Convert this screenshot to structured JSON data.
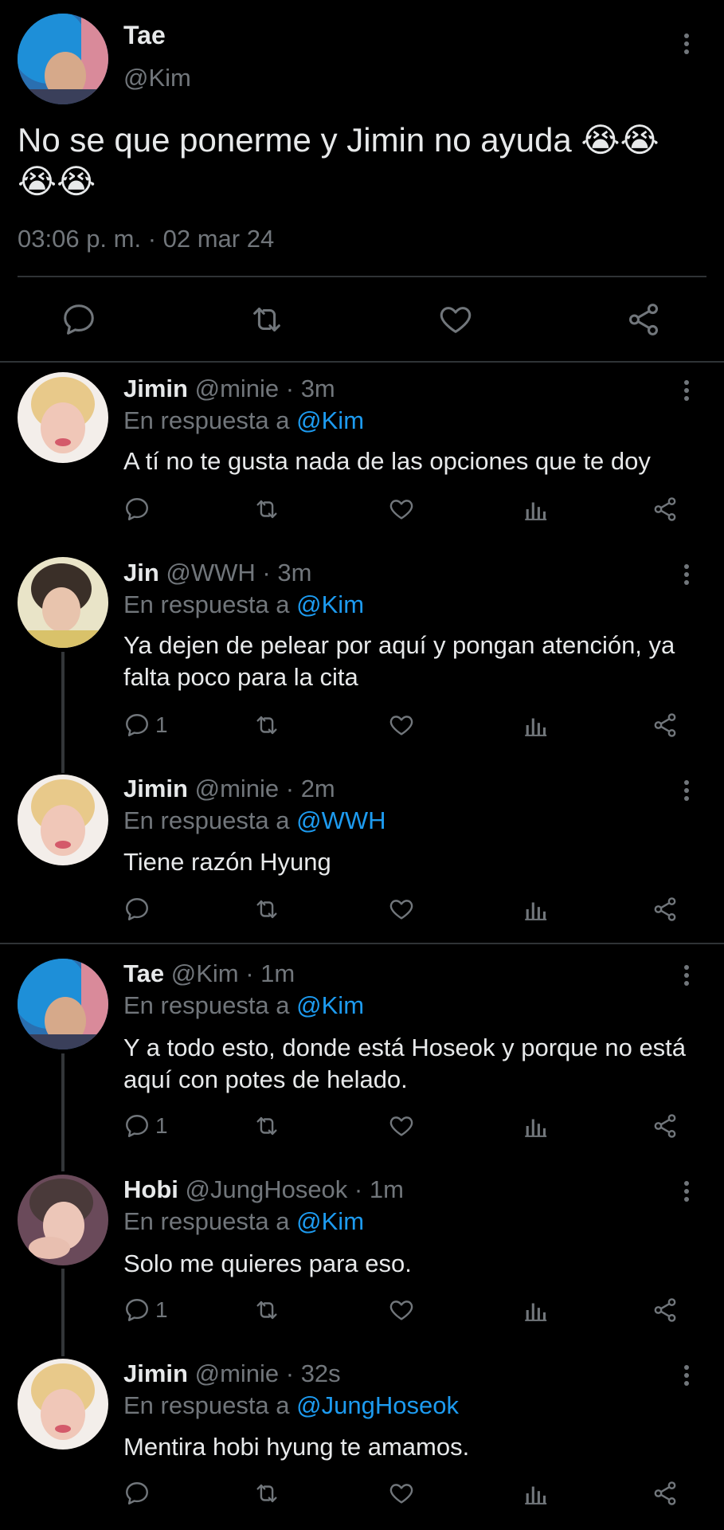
{
  "main_tweet": {
    "name": "Tae",
    "handle": "@Kim",
    "text": "No se que ponerme y Jimin no ayuda 😭😭😭😭",
    "timestamp": "03:06 p. m. · 02 mar 24"
  },
  "replies": [
    {
      "name": "Jimin",
      "meta": "@minie · 3m",
      "reply_prefix": "En respuesta a",
      "reply_to": "@Kim",
      "text": "A tí no te gusta nada de las opciones que te doy",
      "reply_count": ""
    },
    {
      "name": "Jin",
      "meta": "@WWH · 3m",
      "reply_prefix": "En respuesta a",
      "reply_to": "@Kim",
      "text": "Ya dejen de pelear por aquí y pongan atención, ya falta poco para la cita",
      "reply_count": "1"
    },
    {
      "name": "Jimin",
      "meta": "@minie · 2m",
      "reply_prefix": "En respuesta a",
      "reply_to": "@WWH",
      "text": "Tiene razón Hyung",
      "reply_count": ""
    },
    {
      "name": "Tae",
      "meta": "@Kim · 1m",
      "reply_prefix": "En respuesta a",
      "reply_to": "@Kim",
      "text": "Y a todo esto, donde está Hoseok y porque no está aquí con potes de helado.",
      "reply_count": "1"
    },
    {
      "name": "Hobi",
      "meta": "@JungHoseok · 1m",
      "reply_prefix": "En respuesta a",
      "reply_to": "@Kim",
      "text": "Solo me quieres para eso.",
      "reply_count": "1"
    },
    {
      "name": "Jimin",
      "meta": "@minie · 32s",
      "reply_prefix": "En respuesta a",
      "reply_to": "@JungHoseok",
      "text": "Mentira hobi hyung te amamos.",
      "reply_count": ""
    }
  ],
  "icons": {
    "reply": "comment-icon",
    "retweet": "retweet-icon",
    "like": "heart-icon",
    "views": "analytics-icon",
    "share": "share-icon",
    "more": "more-vertical-icon"
  },
  "colors": {
    "background": "#000000",
    "text": "#e7e9ea",
    "muted": "#71767b",
    "link": "#1d9bf0",
    "divider": "#2f3336"
  }
}
